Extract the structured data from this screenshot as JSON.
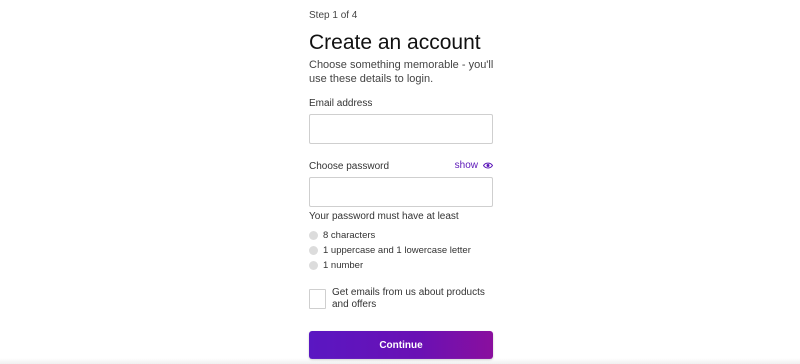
{
  "step": "Step 1 of 4",
  "title": "Create an account",
  "subtitle": "Choose something memorable - you'll use these details to login.",
  "email": {
    "label": "Email address",
    "value": "",
    "placeholder": ""
  },
  "password": {
    "label": "Choose password",
    "value": "",
    "placeholder": "",
    "show_label": "show",
    "show_icon": "eye-icon"
  },
  "requirements": {
    "title": "Your password must have at least",
    "items": [
      "8 characters",
      "1 uppercase and 1 lowercase letter",
      "1 number"
    ]
  },
  "marketing_optin": {
    "label": "Get emails from us about products and offers",
    "checked": false
  },
  "continue_label": "Continue",
  "colors": {
    "accent": "#5b16b8",
    "button_start": "#5a17c2",
    "button_end": "#8a0f9e",
    "requirement_dot": "#dcdcdc"
  }
}
